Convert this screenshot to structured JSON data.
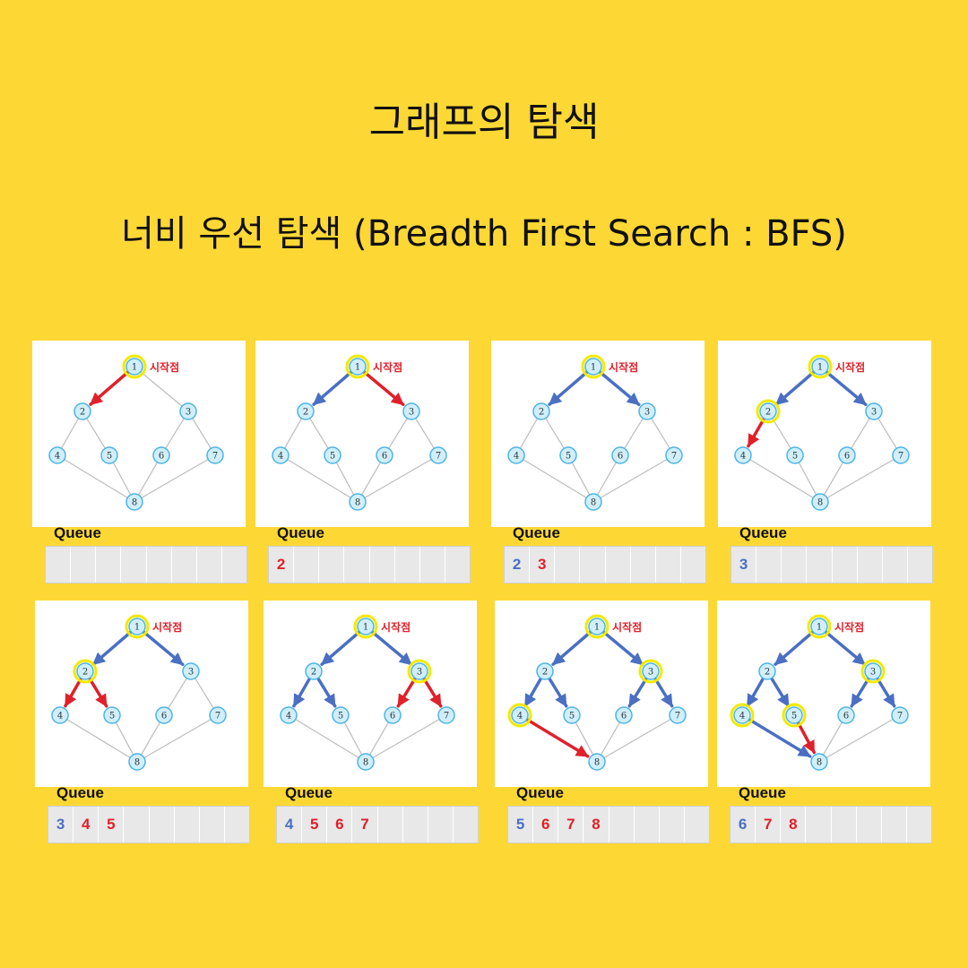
{
  "title": "그래프의 탐색",
  "subtitle": "너비 우선 탐색 (Breadth First Search : BFS)",
  "colors": {
    "background": "#FDD835",
    "visited_edge": "#4A6FC3",
    "active_edge": "#E0202A",
    "plain_edge": "#BDBDBD",
    "node_fill": "#CFEFFC",
    "node_stroke": "#4FB3E6",
    "highlight": "#F2EA00",
    "start_label": "#E0202A"
  },
  "start_label": "시작점",
  "queue_label": "Queue",
  "nodes": [
    "1",
    "2",
    "3",
    "4",
    "5",
    "6",
    "7",
    "8"
  ],
  "edges": [
    [
      "1",
      "2"
    ],
    [
      "1",
      "3"
    ],
    [
      "2",
      "4"
    ],
    [
      "2",
      "5"
    ],
    [
      "3",
      "6"
    ],
    [
      "3",
      "7"
    ],
    [
      "4",
      "8"
    ],
    [
      "5",
      "8"
    ],
    [
      "6",
      "8"
    ],
    [
      "7",
      "8"
    ]
  ],
  "steps": [
    {
      "step": 1,
      "blue_edges": [],
      "red_edges": [
        [
          "1",
          "2"
        ]
      ],
      "highlighted": [
        "1"
      ],
      "queue": []
    },
    {
      "step": 2,
      "blue_edges": [
        [
          "1",
          "2"
        ]
      ],
      "red_edges": [
        [
          "1",
          "3"
        ]
      ],
      "highlighted": [
        "1"
      ],
      "queue": [
        {
          "v": "2",
          "c": "red"
        }
      ]
    },
    {
      "step": 3,
      "blue_edges": [
        [
          "1",
          "2"
        ],
        [
          "1",
          "3"
        ]
      ],
      "red_edges": [],
      "highlighted": [
        "1"
      ],
      "queue": [
        {
          "v": "2",
          "c": "blue"
        },
        {
          "v": "3",
          "c": "red"
        }
      ]
    },
    {
      "step": 4,
      "blue_edges": [
        [
          "1",
          "2"
        ],
        [
          "1",
          "3"
        ]
      ],
      "red_edges": [
        [
          "2",
          "4"
        ]
      ],
      "highlighted": [
        "1",
        "2"
      ],
      "queue": [
        {
          "v": "3",
          "c": "blue"
        }
      ]
    },
    {
      "step": 5,
      "blue_edges": [
        [
          "1",
          "2"
        ],
        [
          "1",
          "3"
        ]
      ],
      "red_edges": [
        [
          "2",
          "4"
        ],
        [
          "2",
          "5"
        ]
      ],
      "highlighted": [
        "1",
        "2"
      ],
      "queue": [
        {
          "v": "3",
          "c": "blue"
        },
        {
          "v": "4",
          "c": "red"
        },
        {
          "v": "5",
          "c": "red"
        }
      ]
    },
    {
      "step": 6,
      "blue_edges": [
        [
          "1",
          "2"
        ],
        [
          "1",
          "3"
        ],
        [
          "2",
          "4"
        ],
        [
          "2",
          "5"
        ]
      ],
      "red_edges": [
        [
          "3",
          "6"
        ],
        [
          "3",
          "7"
        ]
      ],
      "highlighted": [
        "1",
        "3"
      ],
      "queue": [
        {
          "v": "4",
          "c": "blue"
        },
        {
          "v": "5",
          "c": "red"
        },
        {
          "v": "6",
          "c": "red"
        },
        {
          "v": "7",
          "c": "red"
        }
      ]
    },
    {
      "step": 7,
      "blue_edges": [
        [
          "1",
          "2"
        ],
        [
          "1",
          "3"
        ],
        [
          "2",
          "4"
        ],
        [
          "2",
          "5"
        ],
        [
          "3",
          "6"
        ],
        [
          "3",
          "7"
        ]
      ],
      "red_edges": [
        [
          "4",
          "8"
        ]
      ],
      "highlighted": [
        "1",
        "3",
        "4"
      ],
      "queue": [
        {
          "v": "5",
          "c": "blue"
        },
        {
          "v": "6",
          "c": "red"
        },
        {
          "v": "7",
          "c": "red"
        },
        {
          "v": "8",
          "c": "red"
        }
      ]
    },
    {
      "step": 8,
      "blue_edges": [
        [
          "1",
          "2"
        ],
        [
          "1",
          "3"
        ],
        [
          "2",
          "4"
        ],
        [
          "2",
          "5"
        ],
        [
          "3",
          "6"
        ],
        [
          "3",
          "7"
        ],
        [
          "4",
          "8"
        ]
      ],
      "red_edges": [
        [
          "5",
          "8"
        ]
      ],
      "highlighted": [
        "1",
        "3",
        "4",
        "5"
      ],
      "queue": [
        {
          "v": "6",
          "c": "blue"
        },
        {
          "v": "7",
          "c": "red"
        },
        {
          "v": "8",
          "c": "red"
        }
      ]
    }
  ]
}
